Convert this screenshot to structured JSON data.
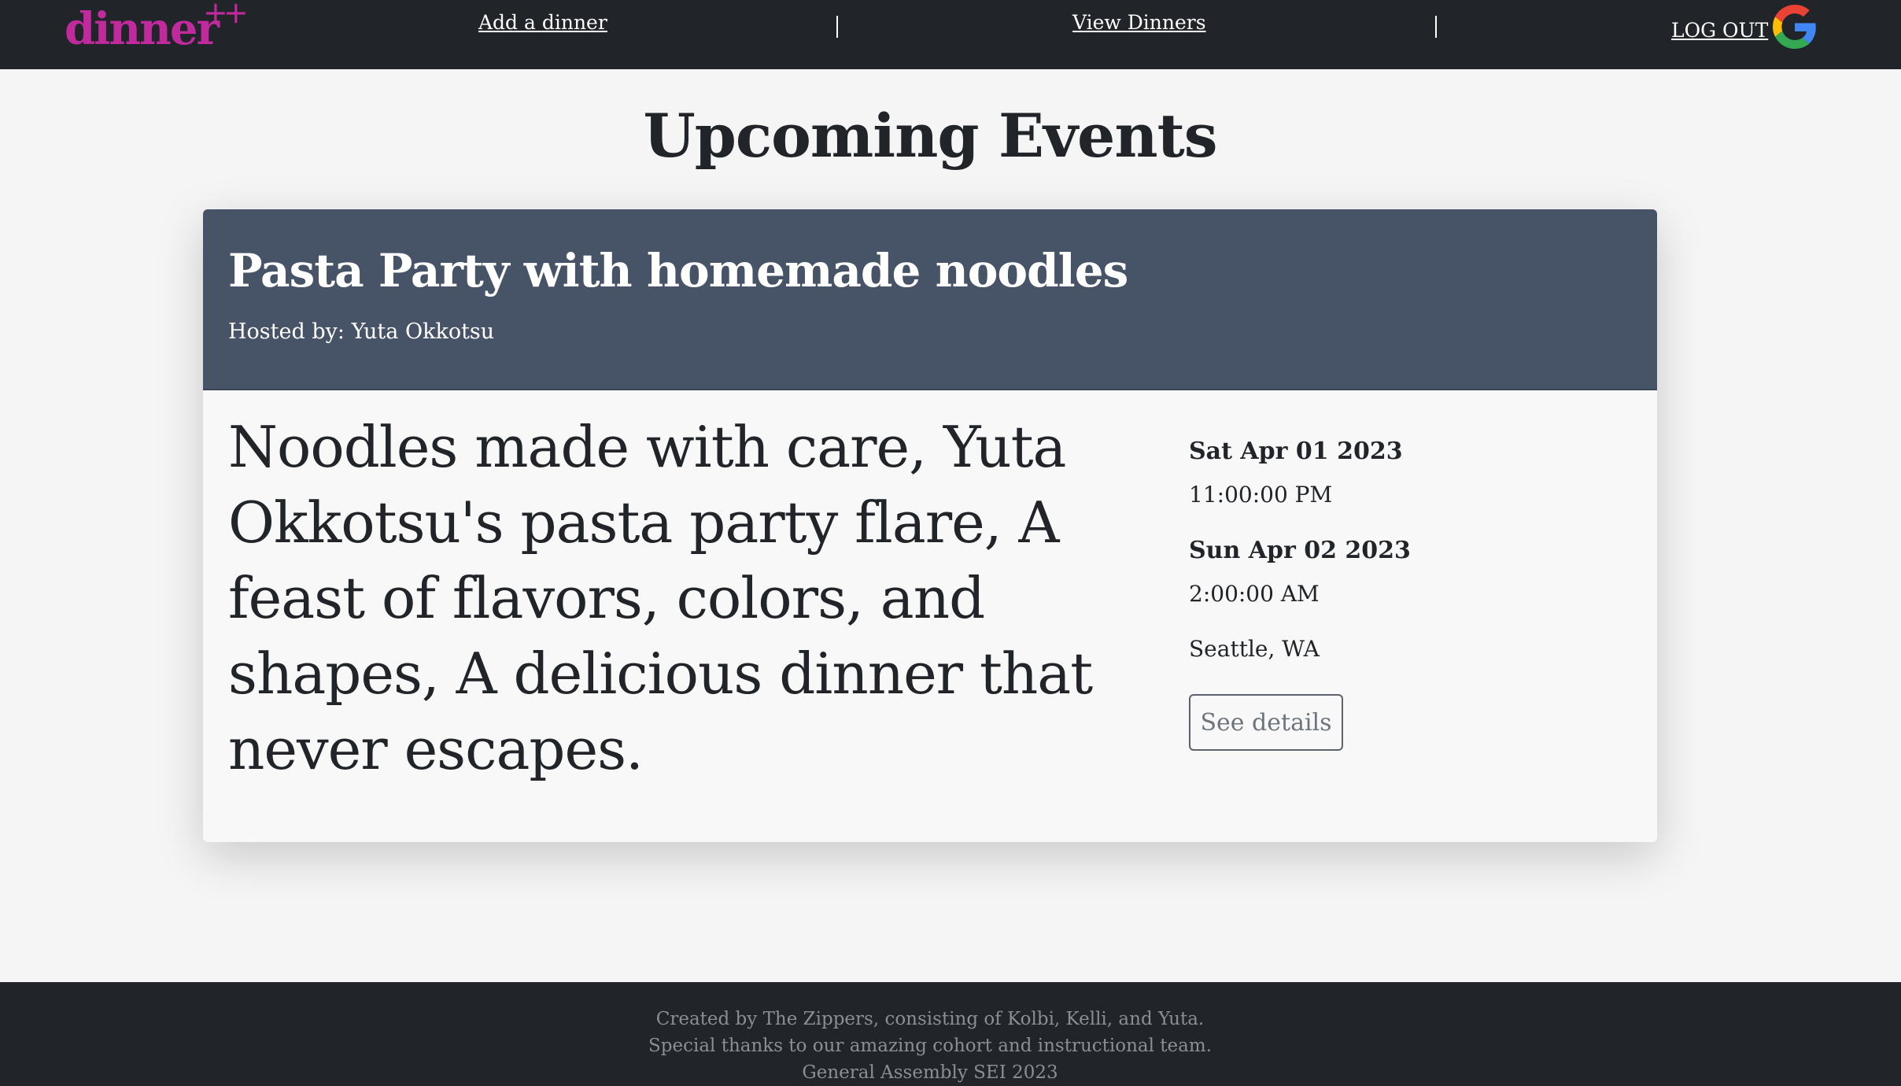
{
  "nav": {
    "logo_text": "dinner",
    "logo_suffix": "++",
    "add_dinner": "Add a dinner",
    "view_dinners": "View Dinners",
    "separator": "|",
    "logout": "LOG OUT",
    "google_icon": "google-g-logo"
  },
  "page": {
    "title": "Upcoming Events"
  },
  "event": {
    "title": "Pasta Party with homemade noodles",
    "hosted_by": "Hosted by: Yuta Okkotsu",
    "description": "Noodles made with care, Yuta Okkotsu's pasta party flare, A feast of flavors, colors, and shapes, A delicious dinner that never escapes.",
    "start_date": "Sat Apr 01 2023",
    "start_time": "11:00:00 PM",
    "end_date": "Sun Apr 02 2023",
    "end_time": "2:00:00 AM",
    "location": "Seattle, WA",
    "details_button": "See details"
  },
  "footer": {
    "line1": "Created by The Zippers, consisting of Kolbi, Kelli, and Yuta.",
    "line2": "Special thanks to our amazing cohort and instructional team.",
    "line3": "General Assembly SEI 2023"
  },
  "colors": {
    "nav_bg": "#212529",
    "brand_magenta": "#c02a9c",
    "card_header_bg": "#475366",
    "page_bg": "#f5f5f5"
  }
}
